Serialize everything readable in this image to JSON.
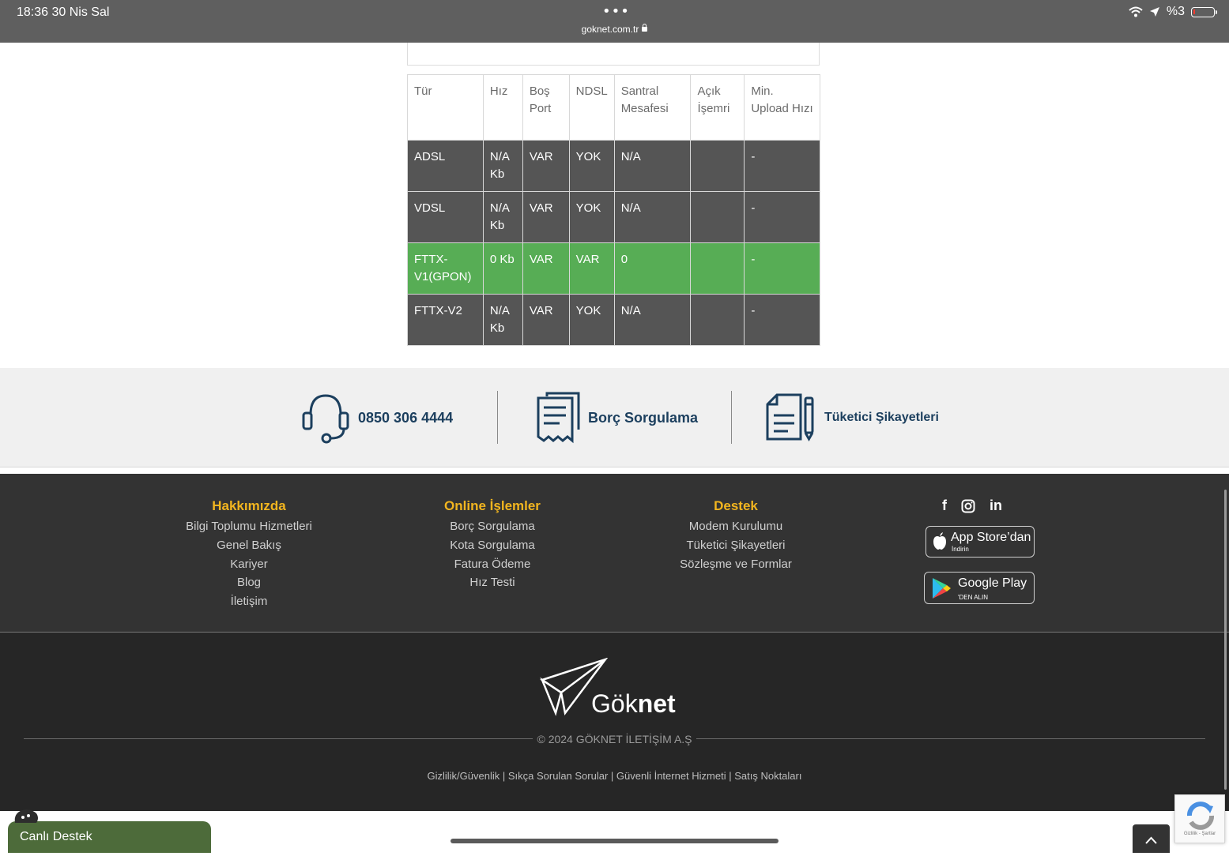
{
  "status_bar": {
    "time": "18:36   30 Nis Sal",
    "dots": "•••",
    "url": "goknet.com.tr",
    "battery": "%3"
  },
  "table": {
    "headers": [
      "Tür",
      "Hız",
      "Boş Port",
      "NDSL",
      "Santral Mesafesi",
      "Açık İşemri",
      "Min. Upload Hızı"
    ],
    "rows": [
      [
        "ADSL",
        "N/A Kb",
        "VAR",
        "YOK",
        "N/A",
        "",
        "-"
      ],
      [
        "VDSL",
        "N/A Kb",
        "VAR",
        "YOK",
        "N/A",
        "",
        "-"
      ],
      [
        "FTTX-V1(GPON)",
        "0 Kb",
        "VAR",
        "VAR",
        "0",
        "",
        "-"
      ],
      [
        "FTTX-V2",
        "N/A Kb",
        "VAR",
        "YOK",
        "N/A",
        "",
        "-"
      ]
    ],
    "active_color": "#57ad55",
    "row_color": "#555555"
  },
  "contact": {
    "phone": "0850 306 4444",
    "debt": "Borç Sorgulama",
    "complaints": "Tüketici Şikayetleri",
    "color": "#1c3f5e"
  },
  "footer": {
    "accent": "#f2b51f",
    "columns": [
      {
        "title": "Hakkımızda",
        "links": [
          "Bilgi Toplumu Hizmetleri",
          "Genel Bakış",
          "Kariyer",
          "Blog",
          "İletişim"
        ]
      },
      {
        "title": "Online İşlemler",
        "links": [
          "Borç Sorgulama",
          "Kota Sorgulama",
          "Fatura Ödeme",
          "Hız Testi"
        ]
      },
      {
        "title": "Destek",
        "links": [
          "Modem Kurulumu",
          "Tüketici Şikayetleri",
          "Sözleşme ve Formlar"
        ]
      }
    ],
    "social": {
      "facebook": "f",
      "linkedin": "in"
    },
    "app_store": {
      "big": "App Store’dan",
      "small": "İndirin"
    },
    "google_play": {
      "big": "Google Play",
      "small": "'DEN ALIN"
    }
  },
  "bottom": {
    "logo_light": "Gök",
    "logo_bold": "net",
    "copyright": "© 2024 GÖKNET İLETİŞİM A.Ş",
    "legal_links": "Gizlilik/Güvenlik | Sıkça Sorulan Sorular | Güvenli İnternet Hizmeti | Satış Noktaları",
    "live_chat": "Canlı Destek",
    "recaptcha_text": "Gizlilik - Şartlar"
  }
}
